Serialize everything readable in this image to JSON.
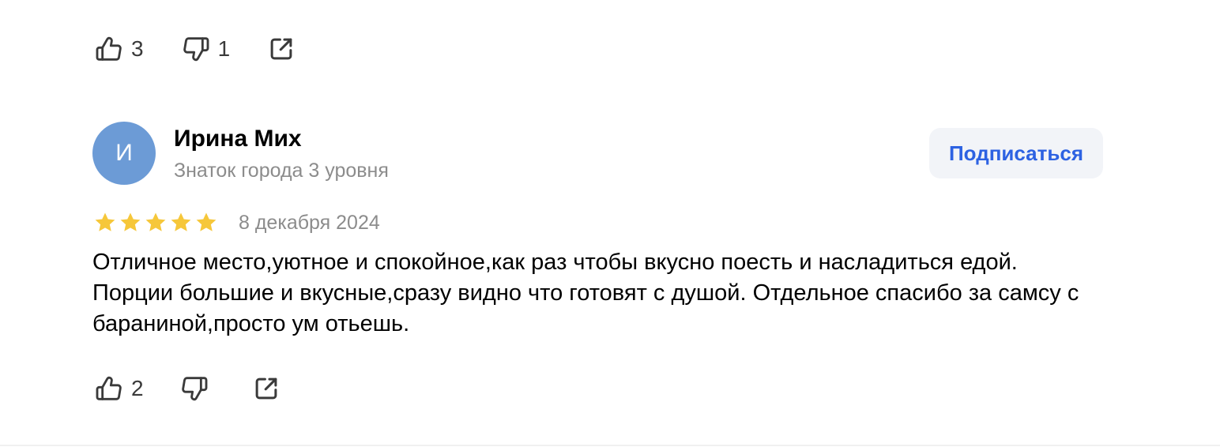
{
  "prev_review": {
    "actions": {
      "likes": "3",
      "dislikes": "1"
    }
  },
  "review": {
    "author": {
      "initial": "И",
      "name": "Ирина Мих",
      "level": "Знаток города 3 уровня",
      "avatar_color": "#6c9bd6"
    },
    "subscribe_label": "Подписаться",
    "rating": 5,
    "max_rating": 5,
    "date": "8 декабря 2024",
    "text": "Отличное место,уютное и спокойное,как раз чтобы вкусно поесть и насладиться едой. Порции большие и вкусные,сразу видно что готовят с душой. Отдельное спасибо за самсу с бараниной,просто ум отьешь.",
    "actions": {
      "likes": "2"
    }
  },
  "colors": {
    "star": "#f6c73a",
    "accent": "#2d62e2",
    "subscribe_bg": "#f2f4f8",
    "muted_text": "#8c8c8c",
    "icon": "#3a3a3a"
  },
  "icons": {
    "like": "thumbs-up-icon",
    "dislike": "thumbs-down-icon",
    "share": "share-external-icon",
    "star": "star-icon"
  }
}
